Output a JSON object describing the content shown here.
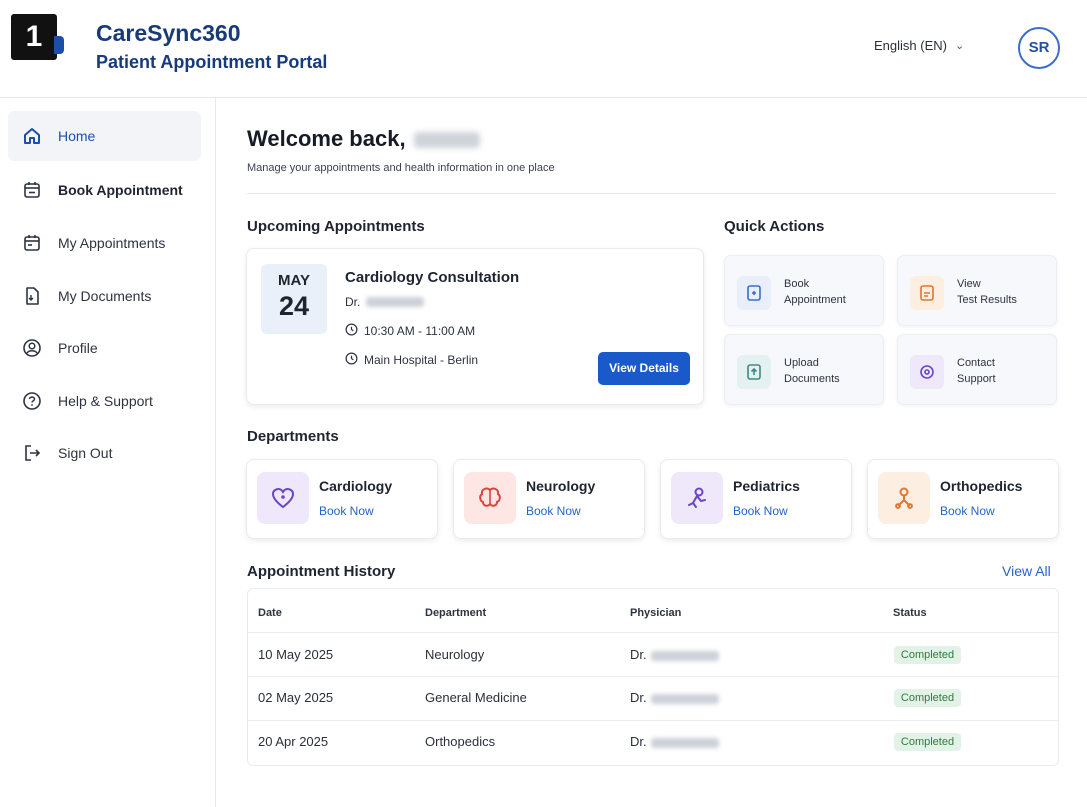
{
  "header": {
    "step_number": "1",
    "brand_title": "CareSync360",
    "brand_subtitle": "Patient Appointment Portal",
    "language": "English (EN)",
    "avatar_initials": "SR"
  },
  "sidebar": {
    "items": [
      {
        "label": "Home",
        "icon": "home-icon"
      },
      {
        "label": "Book Appointment",
        "icon": "calendar-plus-icon"
      },
      {
        "label": "My Appointments",
        "icon": "calendar-icon"
      },
      {
        "label": "My Documents",
        "icon": "document-icon"
      },
      {
        "label": "Profile",
        "icon": "user-circle-icon"
      },
      {
        "label": "Help & Support",
        "icon": "help-circle-icon"
      },
      {
        "label": "Sign Out",
        "icon": "sign-out-icon"
      }
    ]
  },
  "main": {
    "welcome": "Welcome back,",
    "subtitle": "Manage your appointments and health information in one place",
    "upcoming_title": "Upcoming Appointments",
    "appointment": {
      "month": "MAY",
      "day": "24",
      "title": "Cardiology Consultation",
      "doctor_prefix": "Dr.",
      "time": "10:30 AM - 11:00 AM",
      "location": "Main Hospital - Berlin",
      "button": "View Details"
    },
    "quick_actions_title": "Quick Actions",
    "quick_actions": [
      {
        "line1": "Book",
        "line2": "Appointment",
        "color": "#3b6ec9",
        "bg": "#e8eefa"
      },
      {
        "line1": "View",
        "line2": "Test Results",
        "color": "#e0762e",
        "bg": "#fdeee2"
      },
      {
        "line1": "Upload",
        "line2": "Documents",
        "color": "#3e8a86",
        "bg": "#e5f1f0"
      },
      {
        "line1": "Contact",
        "line2": "Support",
        "color": "#6a45c4",
        "bg": "#eee8fa"
      }
    ],
    "departments_title": "Departments",
    "departments": [
      {
        "name": "Cardiology",
        "link": "Book Now",
        "color": "#6a45c4",
        "bg": "#eee8fa"
      },
      {
        "name": "Neurology",
        "link": "Book Now",
        "color": "#d9453a",
        "bg": "#fde6e3"
      },
      {
        "name": "Pediatrics",
        "link": "Book Now",
        "color": "#6a45c4",
        "bg": "#eee8fa"
      },
      {
        "name": "Orthopedics",
        "link": "Book Now",
        "color": "#e0762e",
        "bg": "#fdeee2"
      }
    ],
    "history_title": "Appointment History",
    "view_all": "View All",
    "table": {
      "headers": [
        "Date",
        "Department",
        "Physician",
        "Status"
      ],
      "rows": [
        {
          "date": "10 May 2025",
          "department": "Neurology",
          "physician": "Dr.",
          "status": "Completed"
        },
        {
          "date": "02 May 2025",
          "department": "General Medicine",
          "physician": "Dr.",
          "status": "Completed"
        },
        {
          "date": "20 Apr 2025",
          "department": "Orthopedics",
          "physician": "Dr.",
          "status": "Completed"
        }
      ]
    }
  }
}
